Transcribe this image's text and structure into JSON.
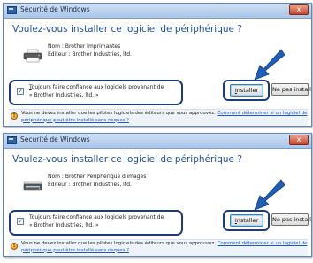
{
  "dialogs": [
    {
      "window_title": "Sécurité de Windows",
      "close_glyph": "x",
      "question": "Voulez-vous installer ce logiciel de périphérique ?",
      "device_name_line": "Nom : Brother Imprimantes",
      "publisher_line": "Éditeur : Brother Industries, ltd.",
      "trust_label_accesskey": "T",
      "trust_label_rest": "oujours faire confiance aux logiciels provenant de",
      "trust_publisher": "« Brother Industries, ltd. »",
      "install_accesskey": "I",
      "install_rest": "nstaller",
      "no_install_prefix": "Ne pas installe",
      "no_install_accesskey": "r",
      "warning_text": "Vous ne devez installer que les pilotes logiciels des éditeurs que vous approuvez.",
      "warning_link": "Comment déterminer si un logiciel de périphérique peut être installé sans risques ?",
      "device_icon": "printer-icon"
    },
    {
      "window_title": "Sécurité de Windows",
      "close_glyph": "x",
      "question": "Voulez-vous installer ce logiciel de périphérique ?",
      "device_name_line": "Nom : Brother Périphérique d'images",
      "publisher_line": "Éditeur : Brother Industries, ltd.",
      "trust_label_accesskey": "T",
      "trust_label_rest": "oujours faire confiance aux logiciels provenant de",
      "trust_publisher": "« Brother Industries, ltd. »",
      "install_accesskey": "I",
      "install_rest": "nstaller",
      "no_install_prefix": "Ne pas installe",
      "no_install_accesskey": "r",
      "warning_text": "Vous ne devez installer que les pilotes logiciels des éditeurs que vous approuvez.",
      "warning_link": "Comment déterminer si un logiciel de périphérique peut être installé sans risques ?",
      "device_icon": "scanner-icon"
    }
  ],
  "colors": {
    "heading": "#1d4f9a",
    "highlight_border": "#1d3a7c",
    "arrow": "#1f5fb8",
    "link": "#1a56c9"
  }
}
